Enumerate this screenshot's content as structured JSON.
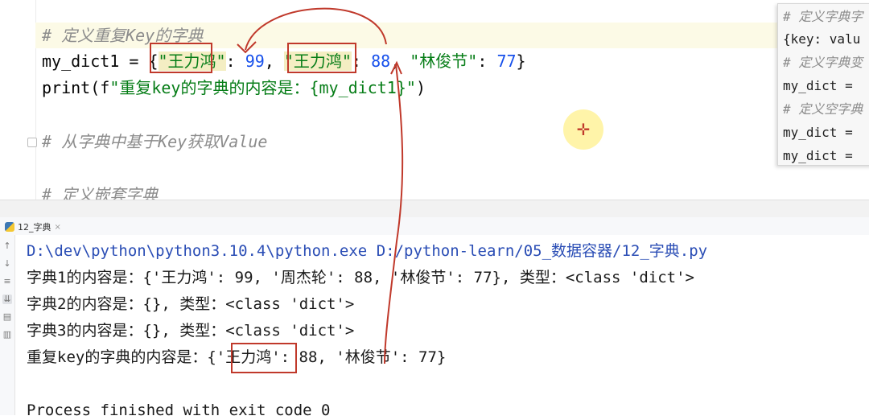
{
  "editor": {
    "line_comment_dup": "# 定义重复Key的字典",
    "line_dict_prefix": "my_dict1 = {",
    "key1": "\"王力鸿\"",
    "sep1": ": ",
    "val1": "99",
    "comma1": ", ",
    "key2": "\"王力鸿\"",
    "sep2": ": ",
    "val2": "88",
    "comma2": ", ",
    "key3": "\"林俊节\"",
    "sep3": ": ",
    "val3": "77",
    "close": "}",
    "print_fn": "print",
    "print_open": "(f",
    "print_str": "\"重复key的字典的内容是：{my_dict1}\"",
    "print_close": ")",
    "line_comment_get": "# 从字典中基于Key获取Value",
    "line_comment_nested": "# 定义嵌套字典"
  },
  "popup": {
    "lines": [
      "# 定义字典字",
      "{key: valu",
      "# 定义字典变",
      "my_dict = ",
      "# 定义空字典",
      "my_dict = ",
      "my_dict = "
    ]
  },
  "run_tab": {
    "label": "12_字典",
    "close": "×"
  },
  "console": {
    "cmd_exe": "D:\\dev\\python\\python3.10.4\\python.exe",
    "cmd_script": "D:/python-learn/05_数据容器/12_字典.py",
    "out1": "字典1的内容是：{'王力鸿': 99, '周杰轮': 88, '林俊节': 77}, 类型：<class 'dict'>",
    "out2": "字典2的内容是：{}, 类型：<class 'dict'>",
    "out3": "字典3的内容是：{}, 类型：<class 'dict'>",
    "out4": "重复key的字典的内容是：{'王力鸿': 88, '林俊节': 77}",
    "exit": "Process finished with exit code 0"
  },
  "side_icons": [
    "arrow-up",
    "arrow-down",
    "wrap",
    "sort",
    "print",
    "trash"
  ],
  "colors": {
    "annotation": "#c0392b",
    "string": "#067d17",
    "number": "#1750eb",
    "comment": "#8c8c8c"
  }
}
